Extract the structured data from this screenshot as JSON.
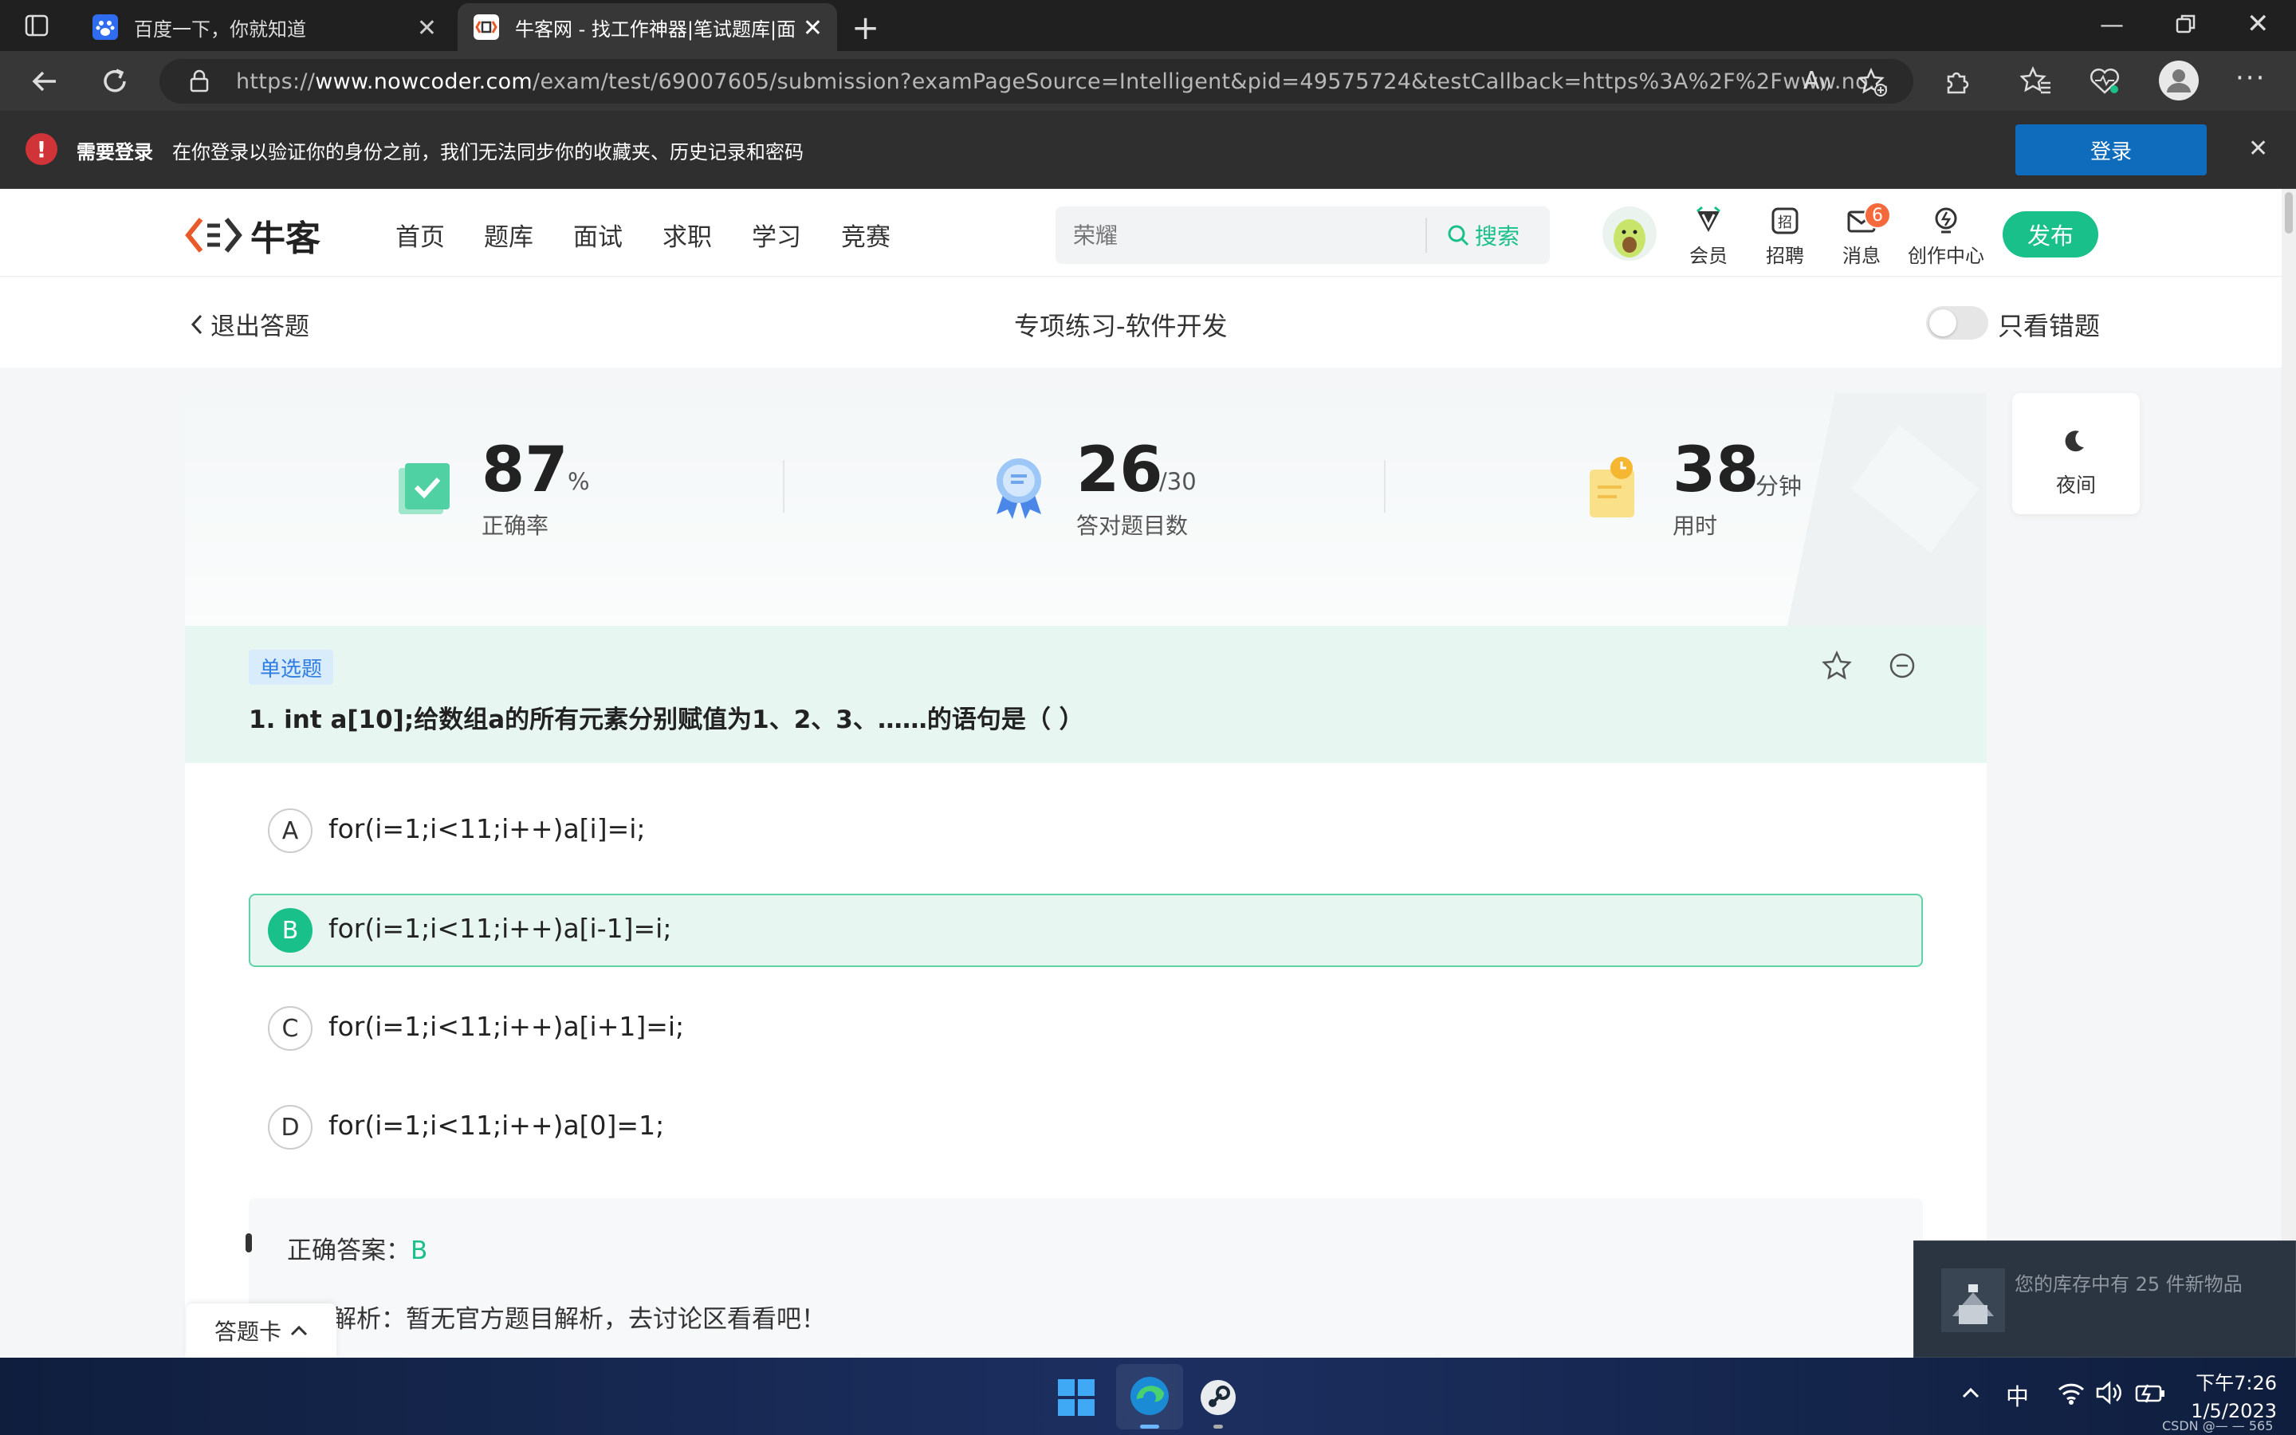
{
  "browser": {
    "tabs": [
      {
        "title": "百度一下，你就知道",
        "icon": "baidu-paw-icon"
      },
      {
        "title": "牛客网 - 找工作神器|笔试题库|面",
        "icon": "nowcoder-icon"
      }
    ],
    "url_prefix": "https://",
    "url_domain": "www.nowcoder.com",
    "url_path": "/exam/test/69007605/submission?examPageSource=Intelligent&pid=49575724&testCallback=https%3A%2F%2Fwww.no...",
    "info_title": "需要登录",
    "info_text": "在你登录以验证你的身份之前，我们无法同步你的收藏夹、历史记录和密码",
    "login_label": "登录"
  },
  "site": {
    "logo_text": "牛客",
    "nav": [
      "首页",
      "题库",
      "面试",
      "求职",
      "学习",
      "竞赛"
    ],
    "search_placeholder": "荣耀",
    "search_label": "搜索",
    "icons": [
      {
        "label": "会员",
        "icon": "vip-icon"
      },
      {
        "label": "招聘",
        "icon": "recruit-icon"
      },
      {
        "label": "消息",
        "icon": "mail-icon",
        "badge": "6"
      },
      {
        "label": "创作中心",
        "icon": "bulb-icon"
      }
    ],
    "publish_label": "发布"
  },
  "subheader": {
    "exit_label": "退出答题",
    "title": "专项练习-软件开发",
    "toggle_label": "只看错题",
    "toggle_on": false
  },
  "stats": [
    {
      "value": "87",
      "unit": "%",
      "label": "正确率",
      "icon": "check-book-icon"
    },
    {
      "value": "26",
      "unit": "/30",
      "label": "答对题目数",
      "icon": "medal-icon"
    },
    {
      "value": "38",
      "unit": "分钟",
      "label": "用时",
      "icon": "clock-note-icon"
    }
  ],
  "night_label": "夜间",
  "question": {
    "type": "单选题",
    "text": "1. int a[10];给数组a的所有元素分别赋值为1、2、3、……的语句是（ ）",
    "options": [
      {
        "letter": "A",
        "text": "for(i=1;i<11;i++)a[i]=i;",
        "selected": false
      },
      {
        "letter": "B",
        "text": "for(i=1;i<11;i++)a[i-1]=i;",
        "selected": true
      },
      {
        "letter": "C",
        "text": "for(i=1;i<11;i++)a[i+1]=i;",
        "selected": false
      },
      {
        "letter": "D",
        "text": "for(i=1;i<11;i++)a[0]=1;",
        "selected": false
      }
    ],
    "answer_label": "正确答案：",
    "answer_value": "B",
    "analysis": "解析：暂无官方题目解析，去讨论区看看吧！"
  },
  "answer_card_label": "答题卡",
  "notification": {
    "text": "您的库存中有 25 件新物品"
  },
  "taskbar": {
    "ime": "中",
    "time": "下午7:26",
    "date": "1/5/2023",
    "watermark": "CSDN @—  —  565"
  },
  "colors": {
    "accent": "#19c08a",
    "login_blue": "#0f6cbd",
    "badge": "#f56a3d"
  }
}
